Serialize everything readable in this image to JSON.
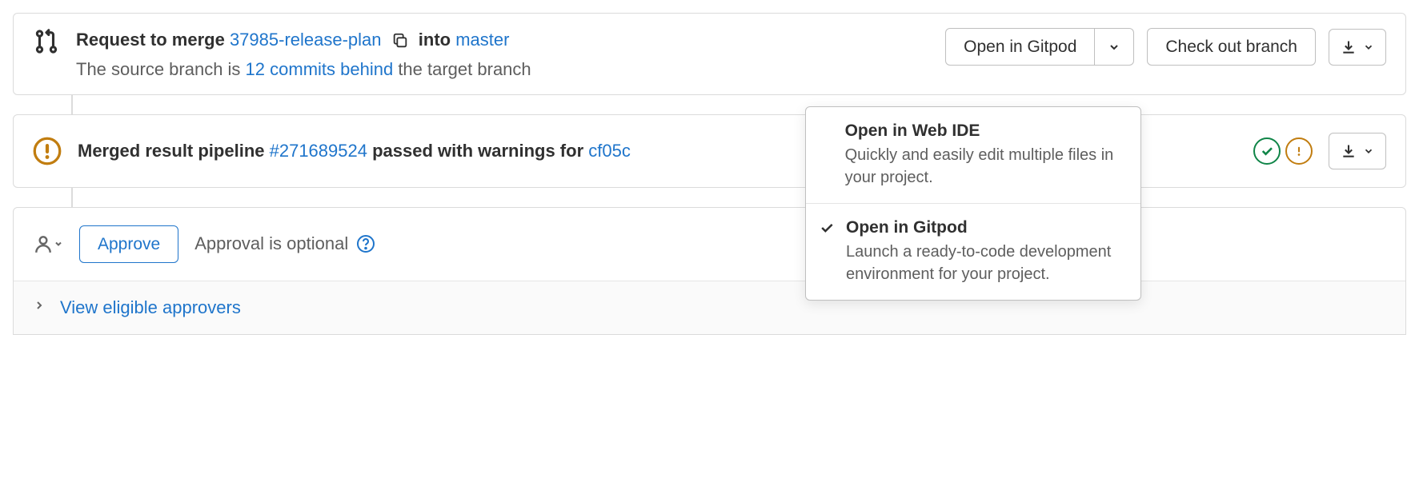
{
  "merge": {
    "request_prefix": "Request to merge ",
    "source_branch": "37985-release-plan",
    "into_text": "  into ",
    "target_branch": "master",
    "subtitle_before": "The source branch is ",
    "commits_behind": "12 commits behind",
    "subtitle_after": " the target branch"
  },
  "actions": {
    "open_button": "Open in Gitpod",
    "checkout_button": "Check out branch"
  },
  "dropdown": {
    "items": [
      {
        "title": "Open in Web IDE",
        "desc": "Quickly and easily edit multiple files in your project.",
        "selected": false
      },
      {
        "title": "Open in Gitpod",
        "desc": "Launch a ready-to-code development environment for your project.",
        "selected": true
      }
    ]
  },
  "pipeline": {
    "prefix": "Merged result pipeline ",
    "pipeline_id": "#271689524",
    "middle": " passed with warnings for ",
    "commit_sha": "cf05c"
  },
  "approval": {
    "approve_button": "Approve",
    "optional_text": "Approval is optional",
    "eligible_link": "View eligible approvers"
  }
}
